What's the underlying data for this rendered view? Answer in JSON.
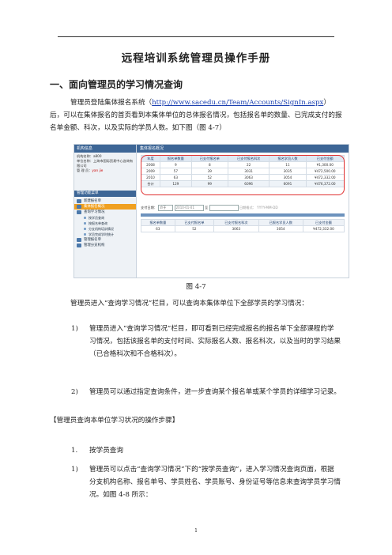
{
  "doc_title": "远程培训系统管理员操作手册",
  "section1_heading": "一、面向管理员的学习情况查询",
  "intro": {
    "before_link": "管理员登陆集体报名系统（",
    "link": "http://www.sacedu.cn/Team/Accounts/SignIn.aspx",
    "after_link": "）后，可以在集体报名的首页看到本集体单位的总体报名情况，包括报名单的数量、已完成支付的报名单金额、科次，以及实际的学员人数。如下图（图 4-7）"
  },
  "figure": {
    "left_title": "机构信息",
    "info_lines": [
      "机构名称：a800",
      "单位名称：上海市国际贸易中心咨询有限公司",
      "管 理 员："
    ],
    "admin_name": "yan jie",
    "mgr_title": "管理功能菜单",
    "menu": [
      {
        "label": "新建报名单",
        "type": "main"
      },
      {
        "label": "集体报名概况",
        "type": "active"
      },
      {
        "label": "查询学习情况",
        "type": "main"
      },
      {
        "label": "按学员查询",
        "type": "sub"
      },
      {
        "label": "按报名单查询",
        "type": "sub"
      },
      {
        "label": "分支机构培训情况",
        "type": "sub"
      },
      {
        "label": "学员完成学时统计",
        "type": "sub"
      },
      {
        "label": "管理报名单",
        "type": "main"
      },
      {
        "label": "管理分支机构",
        "type": "main"
      }
    ],
    "right_title": "集体报名概况",
    "summary_table": {
      "headers": [
        "年度",
        "报名单数量",
        "已支付报名单",
        "已支付报名科次",
        "报名学员人数",
        "已支付金额"
      ],
      "rows": [
        [
          "2008",
          "9",
          "8",
          "22",
          "11",
          "¥1,300.00"
        ],
        [
          "2009",
          "57",
          "39",
          "3031",
          "3035",
          "¥472,500.00"
        ],
        [
          "2010",
          "63",
          "52",
          "3063",
          "3054",
          "¥472,332.00"
        ]
      ],
      "total": [
        "合计",
        "129",
        "99",
        "6096",
        "6091",
        "¥476,372.00"
      ]
    },
    "filter": {
      "label": "支付日期：",
      "op": "介于",
      "date1": "2010-01-01",
      "mid": "至",
      "date2_label": "日期格式：",
      "date2_hint": "YYYY-MM-DD"
    },
    "detail_table": {
      "headers": [
        "报名单数量",
        "已支付报名单",
        "已支付报名科次",
        "已报名学员人数",
        "已支付金额"
      ],
      "row": [
        "63",
        "52",
        "3063",
        "3054",
        "¥472,332.00"
      ]
    }
  },
  "figure_caption": "图 4-7",
  "para2": "管理员进入“查询学习情况”栏目，可以查询本集体单位下全部学员的学习情况：",
  "list1": [
    {
      "num": "1)",
      "text": "管理员进入“查询学习情况”栏目，即可看到已经完成报名的报名单下全部课程的学习情况，包括该报名单的支付时间、实际报名人数、报名科次，以及当时的学习结果（已合格科次和不合格科次）。"
    },
    {
      "num": "2)",
      "text": "管理员可以通过指定查询条件，进一步查询某个报名单或某个学员的详细学习记录。"
    }
  ],
  "steps_heading": "【管理员查询本单位学习状况的操作步骤】",
  "step1": {
    "num": "1.",
    "text": "按学员查询"
  },
  "list2": [
    {
      "num": "1)",
      "text": "管理员可以点击“查询学习情况”下的“按学员查询”，进入学习情况查询页面，根据分支机构名称、报名单号、学员姓名、学员账号、身份证号等信息来查询学员学习情况。如图 4-8 所示："
    }
  ],
  "page_number": "1"
}
